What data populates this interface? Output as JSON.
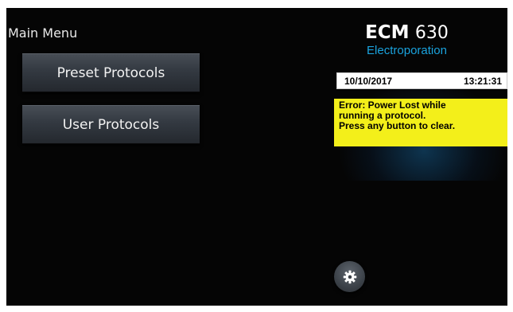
{
  "main_menu": {
    "title": "Main Menu",
    "buttons": [
      {
        "label": "Preset Protocols"
      },
      {
        "label": "User Protocols"
      }
    ]
  },
  "brand": {
    "model_prefix": "ECM",
    "model_number": "630",
    "subtitle": "Electroporation"
  },
  "status": {
    "date": "10/10/2017",
    "time": "13:21:31"
  },
  "error": {
    "lines": [
      "Error: Power Lost while",
      "running a protocol.",
      "Press any button to clear."
    ]
  },
  "settings": {
    "icon": "gear-icon"
  },
  "colors": {
    "background": "#050505",
    "accent_blue": "#1aa3de",
    "error_yellow": "#f3ef1a"
  }
}
